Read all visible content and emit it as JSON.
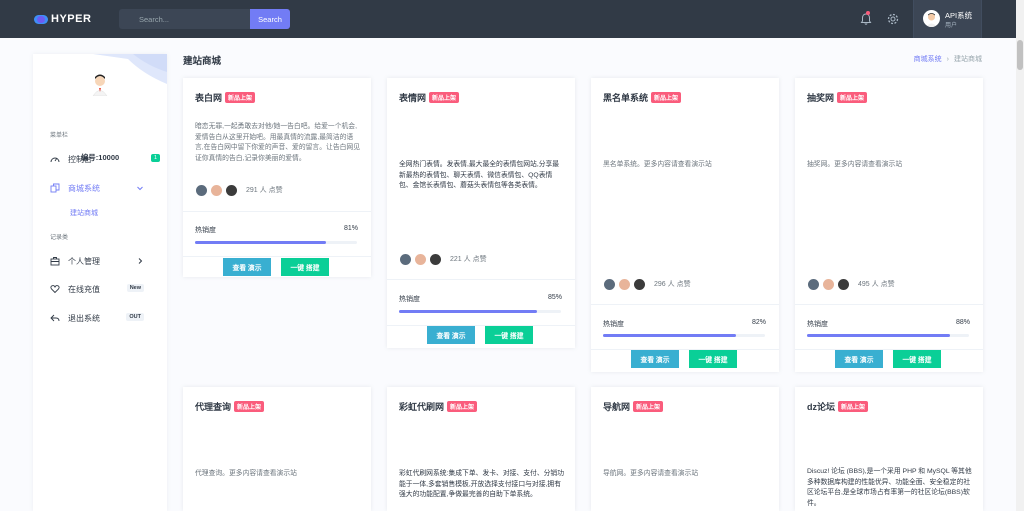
{
  "brand": {
    "name": "HYPER"
  },
  "search": {
    "placeholder": "Search...",
    "button": "Search"
  },
  "user": {
    "name": "API系统",
    "role": "用户"
  },
  "sidebar": {
    "user_id": "编号:10000",
    "sections": [
      "菜单栏",
      "记录类"
    ],
    "items": [
      {
        "label": "控制台",
        "badge": "1"
      },
      {
        "label": "商城系统"
      },
      {
        "label": "个人管理"
      },
      {
        "label": "在线充值",
        "badge": "New"
      },
      {
        "label": "退出系统",
        "badge": "OUT"
      }
    ],
    "sub_item": "建站商城"
  },
  "page": {
    "title": "建站商城",
    "breadcrumb": [
      "商城系统",
      "建站商城"
    ]
  },
  "common": {
    "new_tag": "新品上架",
    "heat_label": "热销度",
    "demo_button": "查看 演示",
    "build_button": "一键 搭建"
  },
  "cards": [
    {
      "title": "表白网",
      "desc": "暗恋无罪,一起勇敢去对他/她一告白吧。给爱一个机会,爱情告白从这里开始吧。用最真情的流露,最简洁的语言,在告白网中留下你爱的声音、爱的留言。让告白网见证你真情的告白,记录你美丽的爱情。",
      "likes": "291 人 点赞",
      "heat": "81%",
      "heat_value": 81
    },
    {
      "title": "表情网",
      "desc": "全网热门表情。发表情,最大最全的表情包网站,分享最新最热的表情包、聊天表情、微信表情包、QQ表情包、金馆长表情包、蘑菇头表情包等各类表情。",
      "likes": "221 人 点赞",
      "heat": "85%",
      "heat_value": 85
    },
    {
      "title": "黑名单系统",
      "desc": "黑名单系统。更多内容请查看演示站",
      "likes": "296 人 点赞",
      "heat": "82%",
      "heat_value": 82
    },
    {
      "title": "抽奖网",
      "desc": "抽奖网。更多内容请查看演示站",
      "likes": "495 人 点赞",
      "heat": "88%",
      "heat_value": 88
    },
    {
      "title": "代理查询",
      "desc": "代理查询。更多内容请查看演示站"
    },
    {
      "title": "彩虹代刷网",
      "desc": "彩虹代刷网系统:集成下单、发卡、对接、支付、分销功能于一体,多套销售模板,开放选择支付接口与对接,拥有强大的功能配置,争做最完善的自助下单系统。"
    },
    {
      "title": "导航网",
      "desc": "导航网。更多内容请查看演示站"
    },
    {
      "title": "dz论坛",
      "desc": "Discuz! 论坛 (BBS),是一个采用 PHP 和 MySQL 等其他多种数据库构建的性能优异、功能全面、安全稳定的社区论坛平台,是全球市场占有率第一的社区论坛(BBS)软件。"
    }
  ]
}
